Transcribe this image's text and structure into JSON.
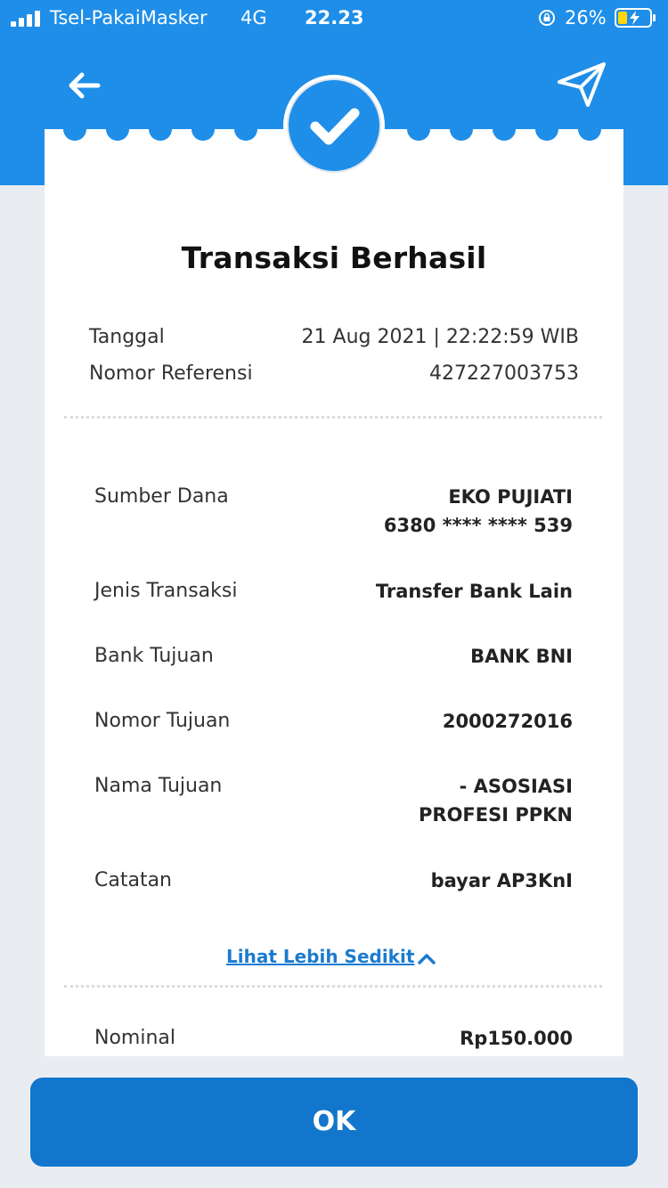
{
  "status_bar": {
    "carrier": "Tsel-PakaiMasker",
    "network": "4G",
    "time": "22.23",
    "battery": "26%"
  },
  "receipt": {
    "title": "Transaksi Berhasil",
    "meta": [
      {
        "label": "Tanggal",
        "value": "21 Aug 2021 | 22:22:59 WIB"
      },
      {
        "label": "Nomor Referensi",
        "value": "427227003753"
      }
    ],
    "details": [
      {
        "label": "Sumber Dana",
        "value": "EKO PUJIATI",
        "value2": "6380 **** **** 539"
      },
      {
        "label": "Jenis Transaksi",
        "value": "Transfer Bank Lain"
      },
      {
        "label": "Bank Tujuan",
        "value": "BANK BNI"
      },
      {
        "label": "Nomor Tujuan",
        "value": "2000272016"
      },
      {
        "label": "Nama Tujuan",
        "value": "- ASOSIASI",
        "value2": "PROFESI PPKN"
      },
      {
        "label": "Catatan",
        "value": "bayar AP3KnI"
      }
    ],
    "toggle_label": "Lihat Lebih Sedikit",
    "amount": {
      "label": "Nominal",
      "value": "Rp150.000"
    }
  },
  "actions": {
    "ok_label": "OK"
  },
  "colors": {
    "header": "#1e8ee8",
    "button": "#1276cc",
    "link": "#1a7bcf"
  }
}
